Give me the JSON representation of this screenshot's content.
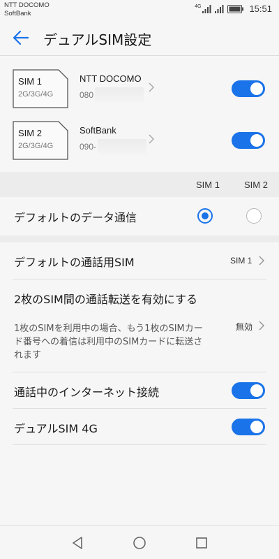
{
  "status": {
    "carrier1": "NTT DOCOMO",
    "carrier2": "SoftBank",
    "network_badge": "4G",
    "time": "15:51"
  },
  "header": {
    "title": "デュアルSIM設定"
  },
  "sims": [
    {
      "slot": "SIM 1",
      "bands": "2G/3G/4G",
      "operator": "NTT DOCOMO",
      "number": "080",
      "enabled": true
    },
    {
      "slot": "SIM 2",
      "bands": "2G/3G/4G",
      "operator": "SoftBank",
      "number": "090-",
      "enabled": true
    }
  ],
  "columns": {
    "sim1": "SIM 1",
    "sim2": "SIM 2"
  },
  "default_data": {
    "label": "デフォルトのデータ通信",
    "selected": "SIM 1"
  },
  "default_call": {
    "label": "デフォルトの通話用SIM",
    "value": "SIM 1"
  },
  "call_forward": {
    "title": "2枚のSIM間の通話転送を有効にする",
    "description": "1枚のSIMを利用中の場合、もう1枚のSIMカード番号への着信は利用中のSIMカードに転送されます",
    "value": "無効"
  },
  "internet_during_call": {
    "label": "通話中のインターネット接続",
    "enabled": true
  },
  "dual_4g": {
    "label": "デュアルSIM 4G",
    "enabled": true
  },
  "icons": {
    "back": "arrow-left-icon",
    "chevron": "chevron-right-icon",
    "nav_back": "triangle-back-icon",
    "nav_home": "circle-home-icon",
    "nav_recent": "square-recent-icon"
  },
  "colors": {
    "accent": "#1a73e8",
    "background": "#f6f6f6",
    "section": "#ececec"
  }
}
